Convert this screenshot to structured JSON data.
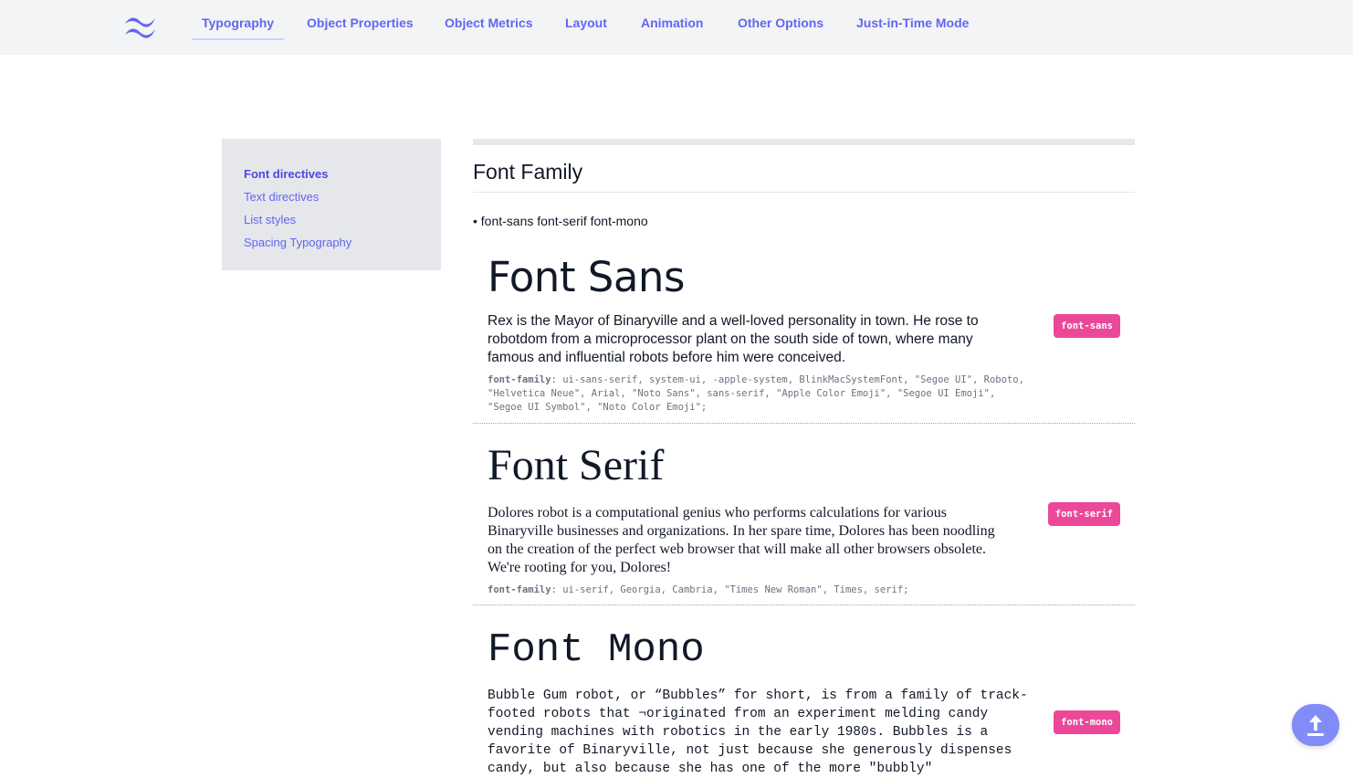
{
  "nav": {
    "logo_icon": "tailwind-logo-icon",
    "items": [
      {
        "label": "Typography",
        "active": true
      },
      {
        "label": "Object Properties"
      },
      {
        "label": "Object Metrics"
      },
      {
        "label": "Layout"
      },
      {
        "label": "Animation"
      },
      {
        "label": "Other Options"
      },
      {
        "label": "Just-in-Time Mode"
      }
    ]
  },
  "sidebar": {
    "items": [
      {
        "label": "Font directives",
        "active": true
      },
      {
        "label": "Text directives"
      },
      {
        "label": "List styles"
      },
      {
        "label": "Spacing Typography"
      }
    ]
  },
  "main": {
    "section_title": "Font Family",
    "class_list": "• font-sans font-serif font-mono",
    "blocks": [
      {
        "heading": "Font Sans",
        "paragraph": "Rex is the Mayor of Binaryville and a well-loved personality in town. He rose to robotdom from a microprocessor plant on the south side of town, where many famous and influential robots before him were conceived.",
        "decl_prop": "font-family",
        "decl_value": ": ui-sans-serif, system-ui, -apple-system, BlinkMacSystemFont, \"Segoe UI\", Roboto, \"Helvetica Neue\", Arial, \"Noto Sans\", sans-serif, \"Apple Color Emoji\", \"Segoe UI Emoji\", \"Segoe UI Symbol\", \"Noto Color Emoji\";",
        "badge": "font-sans"
      },
      {
        "heading": "Font Serif",
        "paragraph": "Dolores robot is a computational genius who performs calculations for various Binaryville businesses and organizations. In her spare time, Dolores has been noodling on the creation of the perfect web browser that will make all other browsers obsolete. We're rooting for you, Dolores!",
        "decl_prop": "font-family",
        "decl_value": ": ui-serif, Georgia, Cambria, \"Times New Roman\", Times, serif;",
        "badge": "font-serif"
      },
      {
        "heading": "Font Mono",
        "paragraph": "Bubble Gum robot, or “Bubbles” for short, is from a family of track-footed robots that ¬originated from an experiment melding candy vending machines with robotics in the early 1980s. Bubbles is a favorite of Binaryville, not just because she generously dispenses candy, but also because she has one of the more \"bubbly\"",
        "badge": "font-mono"
      }
    ]
  },
  "fab": {
    "icon": "arrow-up-icon"
  },
  "colors": {
    "accent": "#6366f1",
    "badge": "#ec4899",
    "nav_bg": "#f3f4f6",
    "sidebar_bg": "#e5e7eb",
    "fab_bg": "#818cf8"
  }
}
